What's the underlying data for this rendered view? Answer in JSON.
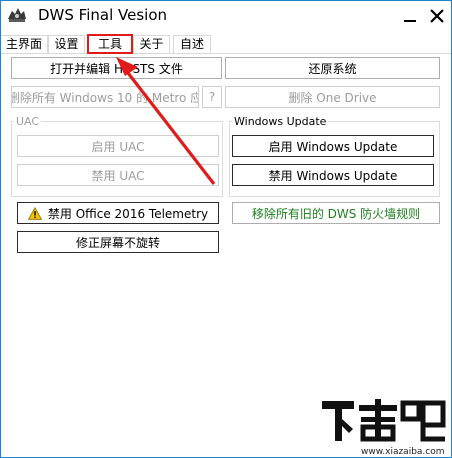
{
  "window": {
    "title": "DWS Final Vesion",
    "minimize_glyph": "—",
    "close_glyph": "✕"
  },
  "tabs": [
    {
      "label": "主界面"
    },
    {
      "label": "设置"
    },
    {
      "label": "工具",
      "active": true
    },
    {
      "label": "关于"
    },
    {
      "label": "自述"
    }
  ],
  "tools": {
    "edit_hosts": "打开并编辑 HOSTS 文件",
    "restore_system": "还原系统",
    "remove_metro": "删除所有 Windows 10 的 Metro 应",
    "help": "?",
    "remove_onedrive": "删除 One Drive",
    "uac": {
      "group_label": "UAC",
      "enable": "启用 UAC",
      "disable": "禁用 UAC"
    },
    "windows_update": {
      "group_label": "Windows Update",
      "enable": "启用 Windows Update",
      "disable": "禁用 Windows Update"
    },
    "disable_office_telemetry": "禁用 Office 2016 Telemetry",
    "remove_firewall_rules": "移除所有旧的 DWS 防火墙规则",
    "fix_screen_rotation": "修正屏幕不旋转"
  },
  "icons": {
    "app": "dws-app-icon",
    "warning": "warning-icon",
    "annotation": "red-arrow-annotation"
  },
  "watermark": {
    "url": "www.xiazaiba.com"
  },
  "colors": {
    "annotation": "#e01b1b",
    "green_text": "#1d7f1d",
    "window_border": "#1e84d0"
  }
}
